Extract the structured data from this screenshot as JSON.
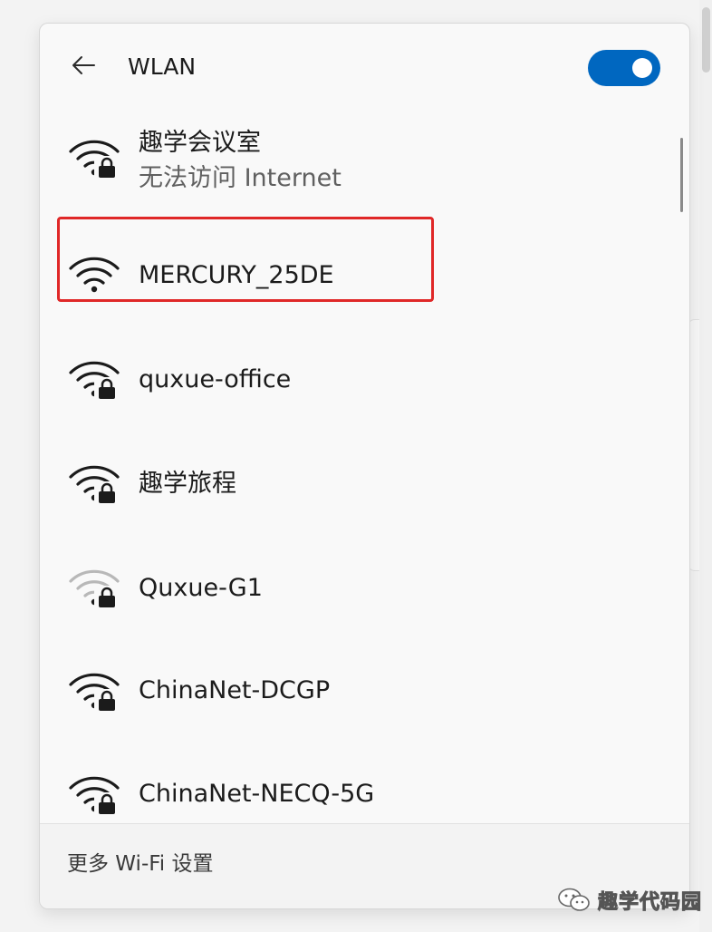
{
  "header": {
    "back_icon": "arrow-left-icon",
    "title": "WLAN",
    "wifi_toggle": {
      "state": "on",
      "color": "#0067c0"
    }
  },
  "networks": [
    {
      "name": "趣学会议室",
      "status": "无法访问 Internet",
      "secured": true,
      "signal": "full"
    },
    {
      "name": "MERCURY_25DE",
      "secured": false,
      "signal": "full",
      "highlighted": true
    },
    {
      "name": "quxue-office",
      "secured": true,
      "signal": "full"
    },
    {
      "name": "趣学旅程",
      "secured": true,
      "signal": "full"
    },
    {
      "name": "Quxue-G1",
      "secured": true,
      "signal": "weak"
    },
    {
      "name": "ChinaNet-DCGP",
      "secured": true,
      "signal": "full"
    },
    {
      "name": "ChinaNet-NECQ-5G",
      "secured": true,
      "signal": "full"
    }
  ],
  "footer": {
    "more_settings_label": "更多 Wi-Fi 设置"
  },
  "watermark": {
    "text": "趣学代码园",
    "icon": "wechat-icon"
  },
  "colors": {
    "accent": "#0067c0",
    "highlight_border": "#e02828",
    "weak_signal": "#b8b8b8"
  }
}
